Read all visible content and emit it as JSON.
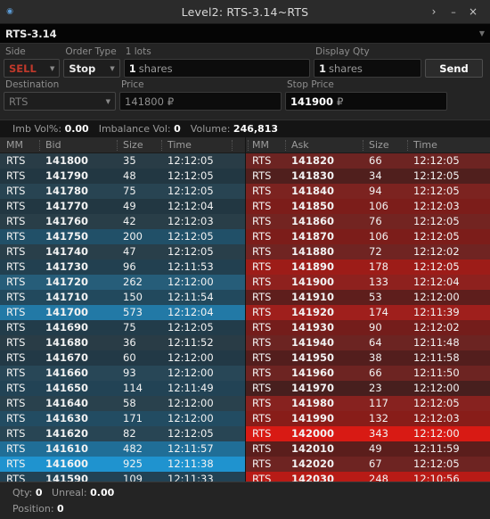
{
  "window": {
    "app_icon": "record-icon",
    "title": "Level2: RTS-3.14~RTS",
    "expand_label": "›",
    "minimize_label": "–",
    "close_label": "×"
  },
  "symbol_bar": {
    "symbol": "RTS-3.14",
    "caret": "▼"
  },
  "order_form": {
    "side": {
      "label": "Side",
      "value": "SELL",
      "caret": "▼"
    },
    "order_type": {
      "label": "Order Type",
      "value": "Stop",
      "caret": "▼"
    },
    "quantity": {
      "label": "1 lots",
      "value": "1",
      "unit": "shares"
    },
    "display_qty": {
      "label": "Display Qty",
      "value": "1",
      "unit": "shares"
    },
    "send": {
      "label": "Send"
    },
    "destination": {
      "label": "Destination",
      "value": "RTS",
      "caret": "▼"
    },
    "price": {
      "label": "Price",
      "value": "141800",
      "currency": "₽"
    },
    "stop_price": {
      "label": "Stop Price",
      "value": "141900",
      "currency": "₽"
    }
  },
  "imbalance_bar": {
    "imb_vol_pct_label": "Imb Vol%:",
    "imb_vol_pct_value": "0.00",
    "imbalance_vol_label": "Imbalance Vol:",
    "imbalance_vol_value": "0",
    "volume_label": "Volume:",
    "volume_value": "246,813"
  },
  "book": {
    "bid_headers": {
      "mm": "MM",
      "price": "Bid",
      "size": "Size",
      "time": "Time"
    },
    "ask_headers": {
      "mm": "MM",
      "price": "Ask",
      "size": "Size",
      "time": "Time"
    },
    "bids": [
      {
        "mm": "RTS",
        "price": "141800",
        "size": "35",
        "time": "12:12:05"
      },
      {
        "mm": "RTS",
        "price": "141790",
        "size": "48",
        "time": "12:12:05"
      },
      {
        "mm": "RTS",
        "price": "141780",
        "size": "75",
        "time": "12:12:05"
      },
      {
        "mm": "RTS",
        "price": "141770",
        "size": "49",
        "time": "12:12:04"
      },
      {
        "mm": "RTS",
        "price": "141760",
        "size": "42",
        "time": "12:12:03"
      },
      {
        "mm": "RTS",
        "price": "141750",
        "size": "200",
        "time": "12:12:05"
      },
      {
        "mm": "RTS",
        "price": "141740",
        "size": "47",
        "time": "12:12:05"
      },
      {
        "mm": "RTS",
        "price": "141730",
        "size": "96",
        "time": "12:11:53"
      },
      {
        "mm": "RTS",
        "price": "141720",
        "size": "262",
        "time": "12:12:00"
      },
      {
        "mm": "RTS",
        "price": "141710",
        "size": "150",
        "time": "12:11:54"
      },
      {
        "mm": "RTS",
        "price": "141700",
        "size": "573",
        "time": "12:12:04"
      },
      {
        "mm": "RTS",
        "price": "141690",
        "size": "75",
        "time": "12:12:05"
      },
      {
        "mm": "RTS",
        "price": "141680",
        "size": "36",
        "time": "12:11:52"
      },
      {
        "mm": "RTS",
        "price": "141670",
        "size": "60",
        "time": "12:12:00"
      },
      {
        "mm": "RTS",
        "price": "141660",
        "size": "93",
        "time": "12:12:00"
      },
      {
        "mm": "RTS",
        "price": "141650",
        "size": "114",
        "time": "12:11:49"
      },
      {
        "mm": "RTS",
        "price": "141640",
        "size": "58",
        "time": "12:12:00"
      },
      {
        "mm": "RTS",
        "price": "141630",
        "size": "171",
        "time": "12:12:00"
      },
      {
        "mm": "RTS",
        "price": "141620",
        "size": "82",
        "time": "12:12:05"
      },
      {
        "mm": "RTS",
        "price": "141610",
        "size": "482",
        "time": "12:11:57"
      },
      {
        "mm": "RTS",
        "price": "141600",
        "size": "925",
        "time": "12:11:38"
      },
      {
        "mm": "RTS",
        "price": "141590",
        "size": "109",
        "time": "12:11:33"
      }
    ],
    "asks": [
      {
        "mm": "RTS",
        "price": "141820",
        "size": "66",
        "time": "12:12:05"
      },
      {
        "mm": "RTS",
        "price": "141830",
        "size": "34",
        "time": "12:12:05"
      },
      {
        "mm": "RTS",
        "price": "141840",
        "size": "94",
        "time": "12:12:05"
      },
      {
        "mm": "RTS",
        "price": "141850",
        "size": "106",
        "time": "12:12:03"
      },
      {
        "mm": "RTS",
        "price": "141860",
        "size": "76",
        "time": "12:12:05"
      },
      {
        "mm": "RTS",
        "price": "141870",
        "size": "106",
        "time": "12:12:05"
      },
      {
        "mm": "RTS",
        "price": "141880",
        "size": "72",
        "time": "12:12:02"
      },
      {
        "mm": "RTS",
        "price": "141890",
        "size": "178",
        "time": "12:12:05"
      },
      {
        "mm": "RTS",
        "price": "141900",
        "size": "133",
        "time": "12:12:04"
      },
      {
        "mm": "RTS",
        "price": "141910",
        "size": "53",
        "time": "12:12:00"
      },
      {
        "mm": "RTS",
        "price": "141920",
        "size": "174",
        "time": "12:11:39"
      },
      {
        "mm": "RTS",
        "price": "141930",
        "size": "90",
        "time": "12:12:02"
      },
      {
        "mm": "RTS",
        "price": "141940",
        "size": "64",
        "time": "12:11:48"
      },
      {
        "mm": "RTS",
        "price": "141950",
        "size": "38",
        "time": "12:11:58"
      },
      {
        "mm": "RTS",
        "price": "141960",
        "size": "66",
        "time": "12:11:50"
      },
      {
        "mm": "RTS",
        "price": "141970",
        "size": "23",
        "time": "12:12:00"
      },
      {
        "mm": "RTS",
        "price": "141980",
        "size": "117",
        "time": "12:12:05"
      },
      {
        "mm": "RTS",
        "price": "141990",
        "size": "132",
        "time": "12:12:03"
      },
      {
        "mm": "RTS",
        "price": "142000",
        "size": "343",
        "time": "12:12:00"
      },
      {
        "mm": "RTS",
        "price": "142010",
        "size": "49",
        "time": "12:11:59"
      },
      {
        "mm": "RTS",
        "price": "142020",
        "size": "67",
        "time": "12:12:05"
      },
      {
        "mm": "RTS",
        "price": "142030",
        "size": "248",
        "time": "12:10:56"
      }
    ]
  },
  "status_bar": {
    "qty_label": "Qty:",
    "qty_value": "0",
    "unreal_label": "Unreal:",
    "unreal_value": "0.00",
    "position_label": "Position:",
    "position_value": "0"
  },
  "colors": {
    "bid_accent": "#1f93cf",
    "ask_accent": "#d81a14",
    "sell_text": "#c0392b",
    "window_bg": "#242424"
  }
}
